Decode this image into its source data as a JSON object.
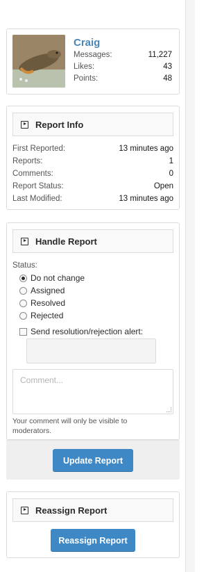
{
  "user": {
    "name": "Craig",
    "stats": [
      {
        "label": "Messages:",
        "value": "11,227"
      },
      {
        "label": "Likes:",
        "value": "43"
      },
      {
        "label": "Points:",
        "value": "48"
      }
    ]
  },
  "report_info": {
    "title": "Report Info",
    "rows": [
      {
        "label": "First Reported:",
        "value": "13 minutes ago"
      },
      {
        "label": "Reports:",
        "value": "1"
      },
      {
        "label": "Comments:",
        "value": "0"
      },
      {
        "label": "Report Status:",
        "value": "Open"
      },
      {
        "label": "Last Modified:",
        "value": "13 minutes ago"
      }
    ]
  },
  "handle_report": {
    "title": "Handle Report",
    "status_label": "Status:",
    "options": [
      "Do not change",
      "Assigned",
      "Resolved",
      "Rejected"
    ],
    "selected": "Do not change",
    "alert_label": "Send resolution/rejection alert:",
    "comment_placeholder": "Comment...",
    "comment_note": "Your comment will only be visible to moderators.",
    "update_button": "Update Report"
  },
  "reassign_report": {
    "title": "Reassign Report",
    "button": "Reassign Report"
  },
  "colors": {
    "accent": "#3d88c5",
    "username": "#4a86b5"
  },
  "icons": {
    "section_icon": "play-square-icon",
    "avatar": "user-avatar-lizard"
  }
}
